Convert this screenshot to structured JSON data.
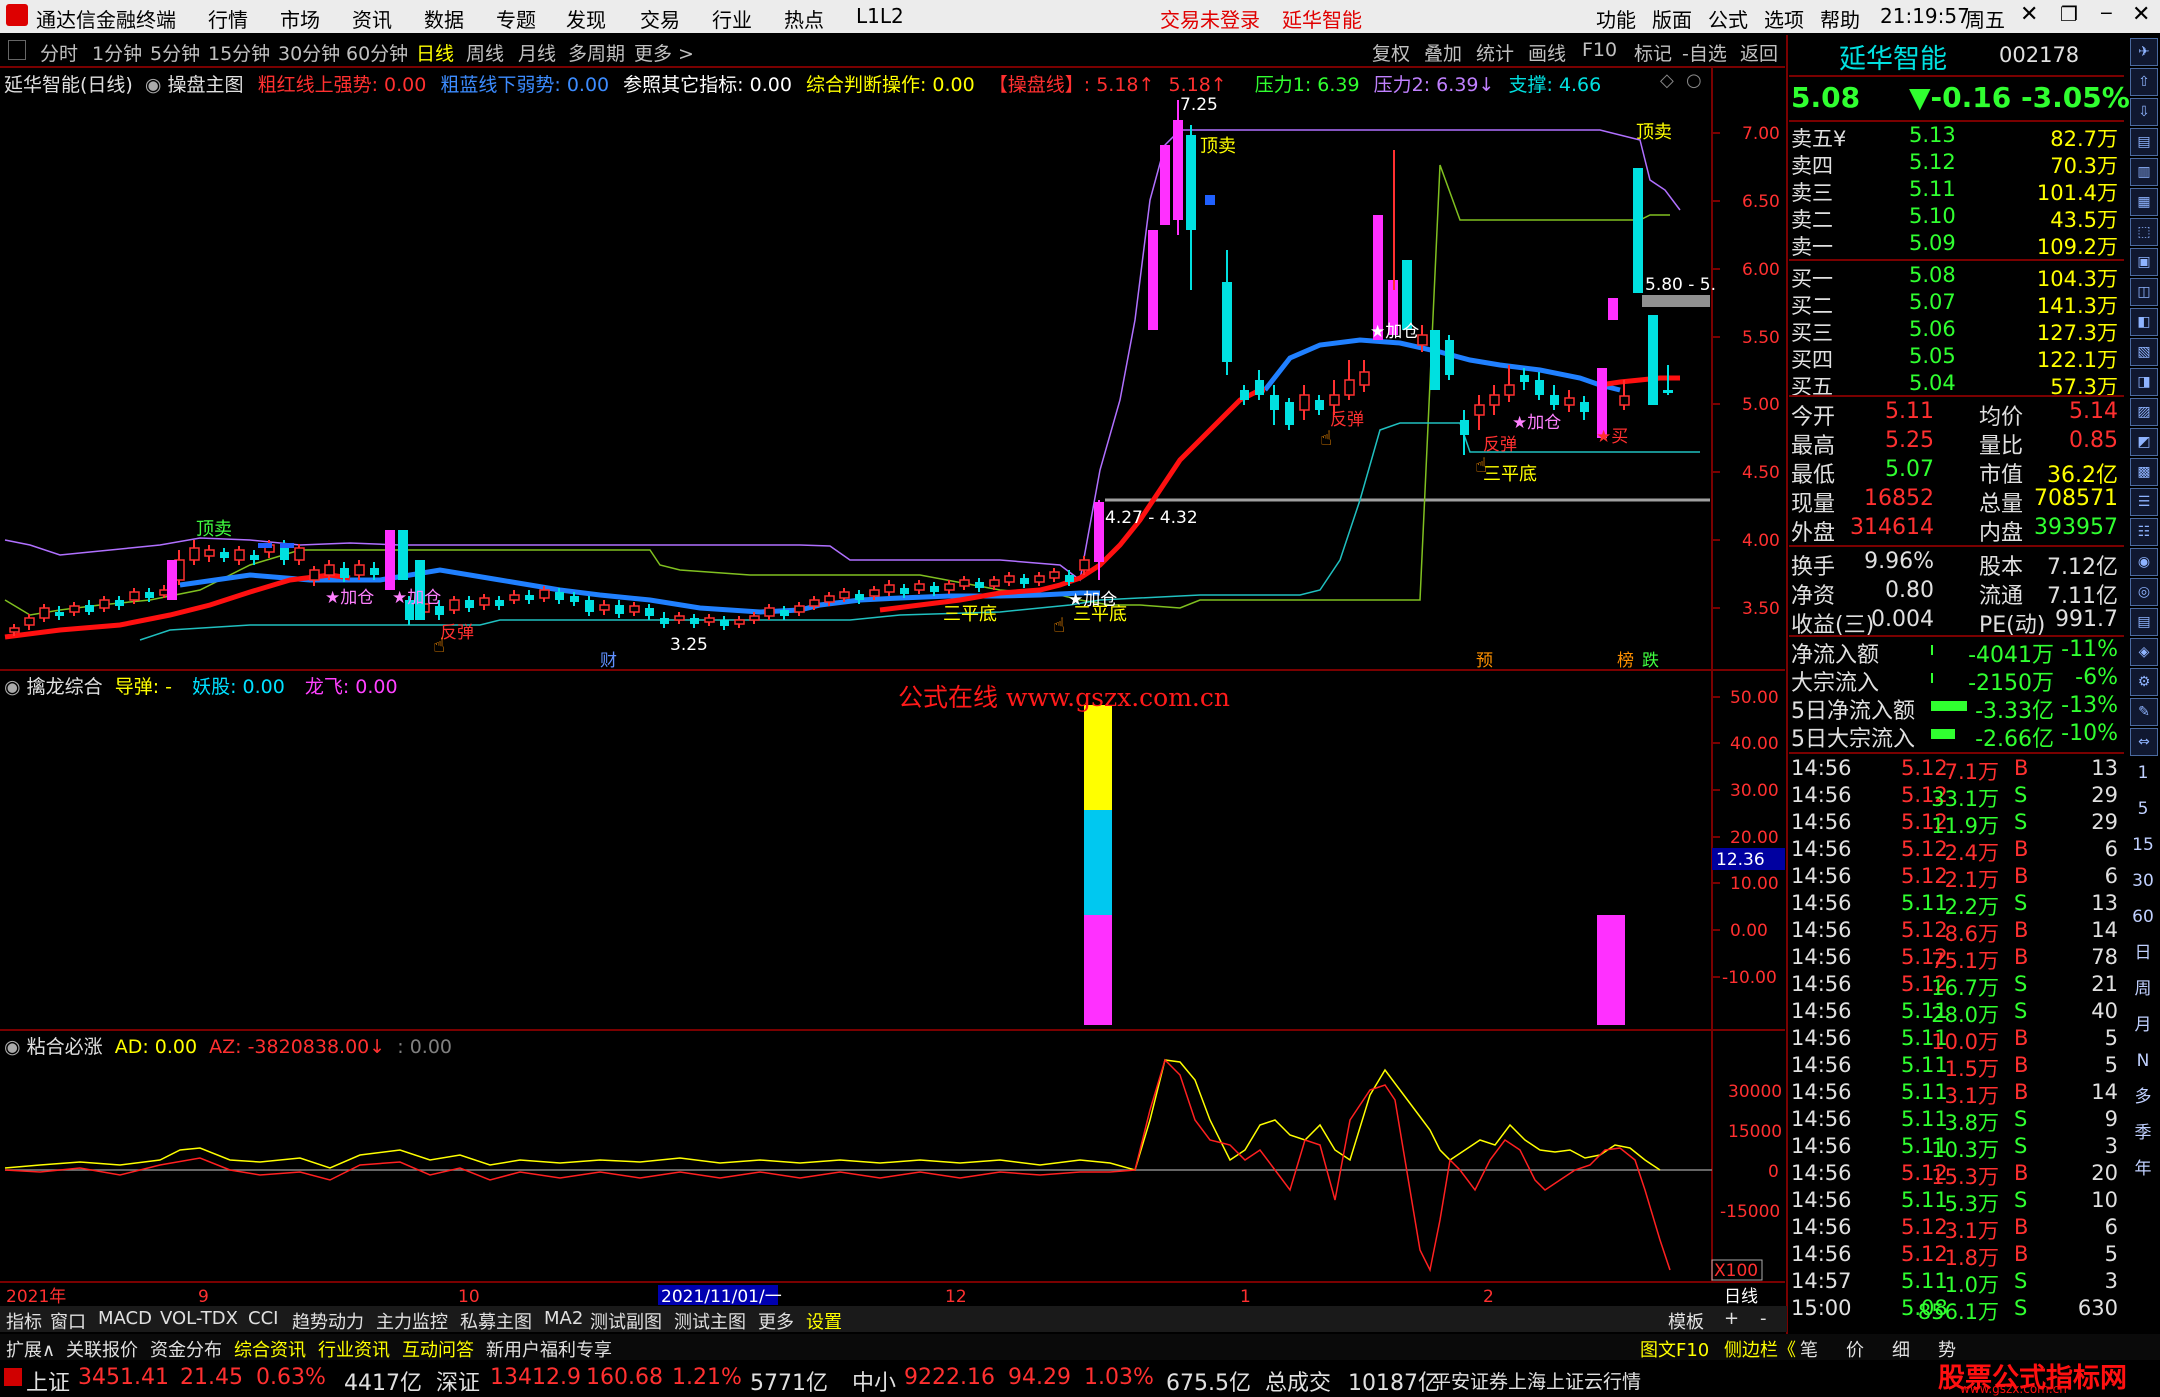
{
  "titlebar": {
    "app_name": "通达信金融终端",
    "menu": [
      "行情",
      "市场",
      "资讯",
      "数据",
      "专题",
      "发现",
      "交易",
      "行业",
      "热点",
      "L1L2"
    ],
    "login": "交易未登录",
    "stock_name": "延华智能",
    "right_menu": [
      "功能",
      "版面",
      "公式",
      "选项",
      "帮助"
    ],
    "time": "21:19:57",
    "weekday": "周五"
  },
  "periods": [
    "分时",
    "1分钟",
    "5分钟",
    "15分钟",
    "30分钟",
    "60分钟",
    "日线",
    "周线",
    "月线",
    "多周期",
    "更多 >"
  ],
  "right_tools": [
    "复权",
    "叠加",
    "统计",
    "画线",
    "F10",
    "标记",
    "-自选",
    "返回"
  ],
  "main_chart": {
    "title": "延华智能(日线)",
    "indicator": "操盘主图",
    "legend": [
      {
        "text": "粗红线上强势: 0.00",
        "color": "#ff3030"
      },
      {
        "text": "粗蓝线下弱势: 0.00",
        "color": "#3c8cff"
      },
      {
        "text": "参照其它指标: 0.00",
        "color": "#ffffff"
      },
      {
        "text": "综合判断操作: 0.00",
        "color": "#ffff00"
      },
      {
        "text": "【操盘线】: 5.18↑",
        "color": "#ff3030"
      },
      {
        "text": "5.18↑",
        "color": "#ff3030"
      },
      {
        "text": "压力1: 6.39",
        "color": "#30ff30"
      },
      {
        "text": "压力2: 6.39↓",
        "color": "#c080ff"
      },
      {
        "text": "支撑: 4.66",
        "color": "#00e0e0"
      }
    ],
    "y_axis": [
      "7.00",
      "6.50",
      "6.00",
      "5.50",
      "5.00",
      "4.50",
      "4.00",
      "3.50"
    ],
    "annotations": {
      "high": "7.25",
      "low": "3.25",
      "range1": "4.27 - 4.32",
      "range2": "5.80 - 5.",
      "top_sell1": "顶卖",
      "top_sell2": "顶卖",
      "early_sell": "顶卖",
      "add1": "★加仓",
      "add2": "★加仓",
      "add3": "★加仓",
      "add4": "★加仓",
      "add5": "★加仓",
      "rebound1": "反弹",
      "rebound2": "反弹",
      "rebound3": "反弹",
      "triple1": "三平底",
      "triple2": "三平底",
      "triple3": "三平底",
      "buy": "★买",
      "cai": "财",
      "yu": "预",
      "bang": "榜",
      "die": "跌"
    }
  },
  "sub1": {
    "title": "擒龙综合",
    "legend": [
      {
        "text": "导弹: -",
        "color": "#ffff00"
      },
      {
        "text": "妖股: 0.00",
        "color": "#00e0ff"
      },
      {
        "text": "龙飞: 0.00",
        "color": "#ff40ff"
      }
    ],
    "watermark": "公式在线   www.gszx.com.cn",
    "y_axis": [
      "50.00",
      "40.00",
      "30.00",
      "20.00",
      "10.00",
      "0.00",
      "-10.00"
    ],
    "current": "12.36"
  },
  "sub2": {
    "title": "粘合必涨",
    "legend": [
      {
        "text": "AD: 0.00",
        "color": "#ffff00"
      },
      {
        "text": "AZ: -3820838.00↓",
        "color": "#ff3030"
      },
      {
        "text": ": 0.00",
        "color": "#808080"
      }
    ],
    "y_axis": [
      "30000",
      "15000",
      "0",
      "-15000"
    ],
    "scale": "X100"
  },
  "x_axis": [
    "2021年",
    "9",
    "10",
    "2021/11/01/一",
    "12",
    "1",
    "2"
  ],
  "x_period": "日线",
  "bottom_tabs": [
    "指标",
    "窗口",
    "MACD",
    "VOL-TDX",
    "CCI",
    "趋势动力",
    "主力监控",
    "私募主图",
    "MA2",
    "测试副图",
    "测试主图",
    "更多",
    "设置"
  ],
  "bottom_right": [
    "模板",
    "+",
    "-"
  ],
  "info_tabs": [
    "扩展∧",
    "关联报价",
    "资金分布",
    "综合资讯",
    "行业资讯",
    "互动问答",
    "新用户福利专享"
  ],
  "info_right": [
    "图文F10",
    "侧边栏《",
    "笔",
    "价",
    "细",
    "势"
  ],
  "status": {
    "items": [
      {
        "name": "上证",
        "price": "3451.41",
        "chg": "21.45",
        "pct": "0.63%",
        "vol": "4417亿"
      },
      {
        "name": "深证",
        "price": "13412.9",
        "chg": "160.68",
        "pct": "1.21%",
        "vol": "5771亿"
      },
      {
        "name": "中小",
        "price": "9222.16",
        "chg": "94.29",
        "pct": "1.03%",
        "vol": "675.5亿"
      }
    ],
    "total_label": "总成交",
    "total": "10187亿",
    "source": "平安证券上海上证云行情",
    "brand": "股票公式指标网",
    "brand_url": "www.gszx.com.cn"
  },
  "quote": {
    "name": "延华智能",
    "code": "002178",
    "price": "5.08",
    "change": "▼-0.16",
    "pct": "-3.05%",
    "asks": [
      {
        "label": "卖五¥",
        "price": "5.13",
        "vol": "82.7万"
      },
      {
        "label": "卖四",
        "price": "5.12",
        "vol": "70.3万"
      },
      {
        "label": "卖三",
        "price": "5.11",
        "vol": "101.4万"
      },
      {
        "label": "卖二",
        "price": "5.10",
        "vol": "43.5万"
      },
      {
        "label": "卖一",
        "price": "5.09",
        "vol": "109.2万"
      }
    ],
    "bids": [
      {
        "label": "买一",
        "price": "5.08",
        "vol": "104.3万"
      },
      {
        "label": "买二",
        "price": "5.07",
        "vol": "141.3万"
      },
      {
        "label": "买三",
        "price": "5.06",
        "vol": "127.3万"
      },
      {
        "label": "买四",
        "price": "5.05",
        "vol": "122.1万"
      },
      {
        "label": "买五",
        "price": "5.04",
        "vol": "57.3万"
      }
    ],
    "stats": [
      [
        "今开",
        "5.11",
        "均价",
        "5.14"
      ],
      [
        "最高",
        "5.25",
        "量比",
        "0.85"
      ],
      [
        "最低",
        "5.07",
        "市值",
        "36.2亿"
      ],
      [
        "现量",
        "16852",
        "总量",
        "708571"
      ],
      [
        "外盘",
        "314614",
        "内盘",
        "393957"
      ]
    ],
    "fundamentals": [
      [
        "换手",
        "9.96%",
        "股本",
        "7.12亿"
      ],
      [
        "净资",
        "0.80",
        "流通",
        "7.11亿"
      ],
      [
        "收益(三)",
        "0.004",
        "PE(动)",
        "991.7"
      ]
    ],
    "flows": [
      {
        "label": "净流入额",
        "value": "-4041万",
        "pct": "-11%",
        "bar": 0.02
      },
      {
        "label": "大宗流入",
        "value": "-2150万",
        "pct": "-6%",
        "bar": 0.02
      },
      {
        "label": "5日净流入额",
        "value": "-3.33亿",
        "pct": "-13%",
        "bar": 0.6
      },
      {
        "label": "5日大宗流入",
        "value": "-2.66亿",
        "pct": "-10%",
        "bar": 0.4
      }
    ],
    "deals": [
      [
        "14:56",
        "5.12",
        "7.1万",
        "B",
        "13"
      ],
      [
        "14:56",
        "5.12",
        "33.1万",
        "S",
        "29"
      ],
      [
        "14:56",
        "5.12",
        "11.9万",
        "S",
        "29"
      ],
      [
        "14:56",
        "5.12",
        "2.4万",
        "B",
        "6"
      ],
      [
        "14:56",
        "5.12",
        "2.1万",
        "B",
        "6"
      ],
      [
        "14:56",
        "5.11",
        "2.2万",
        "S",
        "13"
      ],
      [
        "14:56",
        "5.12",
        "8.6万",
        "B",
        "14"
      ],
      [
        "14:56",
        "5.12",
        "75.1万",
        "B",
        "78"
      ],
      [
        "14:56",
        "5.12",
        "16.7万",
        "S",
        "21"
      ],
      [
        "14:56",
        "5.11",
        "28.0万",
        "S",
        "40"
      ],
      [
        "14:56",
        "5.11",
        "10.0万",
        "B",
        "5"
      ],
      [
        "14:56",
        "5.11",
        "1.5万",
        "B",
        "5"
      ],
      [
        "14:56",
        "5.11",
        "3.1万",
        "B",
        "14"
      ],
      [
        "14:56",
        "5.11",
        "3.8万",
        "S",
        "9"
      ],
      [
        "14:56",
        "5.11",
        "10.3万",
        "S",
        "3"
      ],
      [
        "14:56",
        "5.12",
        "15.3万",
        "B",
        "20"
      ],
      [
        "14:56",
        "5.11",
        "5.3万",
        "S",
        "10"
      ],
      [
        "14:56",
        "5.12",
        "3.1万",
        "B",
        "6"
      ],
      [
        "14:56",
        "5.12",
        "1.8万",
        "B",
        "5"
      ],
      [
        "14:57",
        "5.11",
        "1.0万",
        "S",
        "3"
      ],
      [
        "15:00",
        "5.08",
        "856.1万",
        "S",
        "630"
      ]
    ]
  },
  "side_icons": [
    "1",
    "5",
    "15",
    "30",
    "60",
    "日",
    "周",
    "月",
    "N",
    "多",
    "季",
    "年"
  ],
  "colors": {
    "up": "#ff3030",
    "down": "#00e0e0",
    "ma_red": "#ff1010",
    "ma_blue": "#2080ff",
    "magenta": "#ff30ff",
    "yellow": "#ffff00"
  }
}
